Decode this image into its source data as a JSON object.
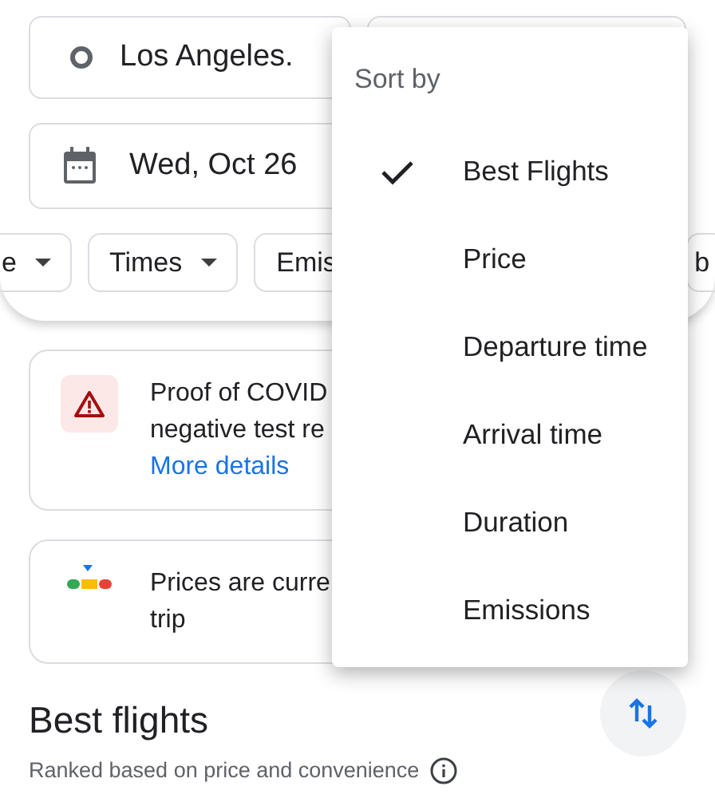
{
  "search": {
    "origin": "Los Angeles.",
    "date": "Wed, Oct 26"
  },
  "filters": [
    {
      "label": "e",
      "dropdown": true
    },
    {
      "label": "Times",
      "dropdown": true
    },
    {
      "label": "Emis"
    },
    {
      "label": "b"
    }
  ],
  "notices": [
    {
      "kind": "warning",
      "lines": [
        "Proof of COVID",
        "negative test re"
      ],
      "link": "More details"
    },
    {
      "kind": "price",
      "lines": [
        "Prices are curre",
        "trip"
      ]
    }
  ],
  "results": {
    "title": "Best flights",
    "subtitle": "Ranked based on price and convenience"
  },
  "sort_menu": {
    "title": "Sort by",
    "options": [
      {
        "label": "Best Flights",
        "selected": true
      },
      {
        "label": "Price",
        "selected": false
      },
      {
        "label": "Departure time",
        "selected": false
      },
      {
        "label": "Arrival time",
        "selected": false
      },
      {
        "label": "Duration",
        "selected": false
      },
      {
        "label": "Emissions",
        "selected": false
      }
    ]
  }
}
